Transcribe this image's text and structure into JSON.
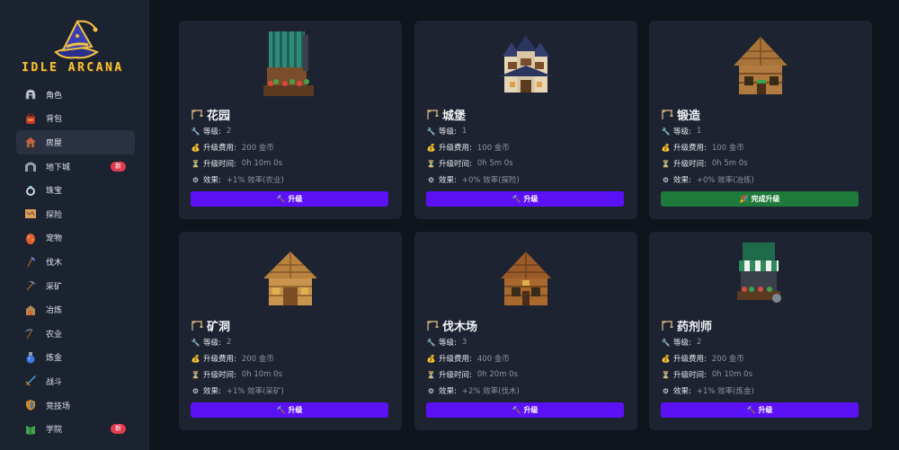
{
  "app": {
    "logo_text": "IDLE ARCANA"
  },
  "nav": [
    {
      "label": "角色",
      "icon": "helmet-icon",
      "color": "#c9ccd4"
    },
    {
      "label": "背包",
      "icon": "backpack-icon",
      "color": "#c0392b"
    },
    {
      "label": "房屋",
      "icon": "house-icon",
      "color": "#d35f3a",
      "active": true
    },
    {
      "label": "地下城",
      "icon": "dungeon-gate-icon",
      "color": "#9aa0aa",
      "badge": "新"
    },
    {
      "label": "珠宝",
      "icon": "ring-icon",
      "color": "#cfd3da"
    },
    {
      "label": "探险",
      "icon": "map-icon",
      "color": "#d9a05b"
    },
    {
      "label": "宠物",
      "icon": "pet-egg-icon",
      "color": "#e0602c"
    },
    {
      "label": "伐木",
      "icon": "axe-icon",
      "color": "#6d7bd4"
    },
    {
      "label": "采矿",
      "icon": "pickaxe-icon",
      "color": "#8c95a3"
    },
    {
      "label": "冶炼",
      "icon": "furnace-icon",
      "color": "#b08a55"
    },
    {
      "label": "农业",
      "icon": "scythe-icon",
      "color": "#7d8794"
    },
    {
      "label": "炼金",
      "icon": "potion-icon",
      "color": "#3d7be0"
    },
    {
      "label": "战斗",
      "icon": "sword-icon",
      "color": "#4fa3e0"
    },
    {
      "label": "竞技场",
      "icon": "shield-icon",
      "color": "#c9892e"
    },
    {
      "label": "学院",
      "icon": "book-icon",
      "color": "#3fa34d",
      "badge": "新"
    }
  ],
  "labels": {
    "level": "等级:",
    "cost": "升级费用:",
    "time": "升级时间:",
    "effect": "效果:"
  },
  "cards": [
    {
      "name": "花园",
      "image": "garden-building-icon",
      "level": "2",
      "cost": "200 金币",
      "time": "0h 10m 0s",
      "effect": "+1% 效率(农业)",
      "button": "升级"
    },
    {
      "name": "城堡",
      "image": "castle-building-icon",
      "level": "1",
      "cost": "100 金币",
      "time": "0h 5m 0s",
      "effect": "+0% 效率(探险)",
      "button": "升级"
    },
    {
      "name": "锻造",
      "image": "forge-building-icon",
      "level": "1",
      "cost": "100 金币",
      "time": "0h 5m 0s",
      "effect": "+0% 效率(冶炼)",
      "button": "完成升级",
      "complete": true
    },
    {
      "name": "矿洞",
      "image": "mine-building-icon",
      "level": "2",
      "cost": "200 金币",
      "time": "0h 10m 0s",
      "effect": "+1% 效率(采矿)",
      "button": "升级"
    },
    {
      "name": "伐木场",
      "image": "lumberyard-building-icon",
      "level": "3",
      "cost": "400 金币",
      "time": "0h 20m 0s",
      "effect": "+2% 效率(伐木)",
      "button": "升级"
    },
    {
      "name": "药剂师",
      "image": "apothecary-building-icon",
      "level": "2",
      "cost": "200 金币",
      "time": "0h 10m 0s",
      "effect": "+1% 效率(炼金)",
      "button": "升级"
    }
  ],
  "colors": {
    "accent": "#5b11f5",
    "complete": "#1e7a3a",
    "badge": "#e23b4f",
    "background": "#10141d",
    "card": "#1d2330"
  }
}
